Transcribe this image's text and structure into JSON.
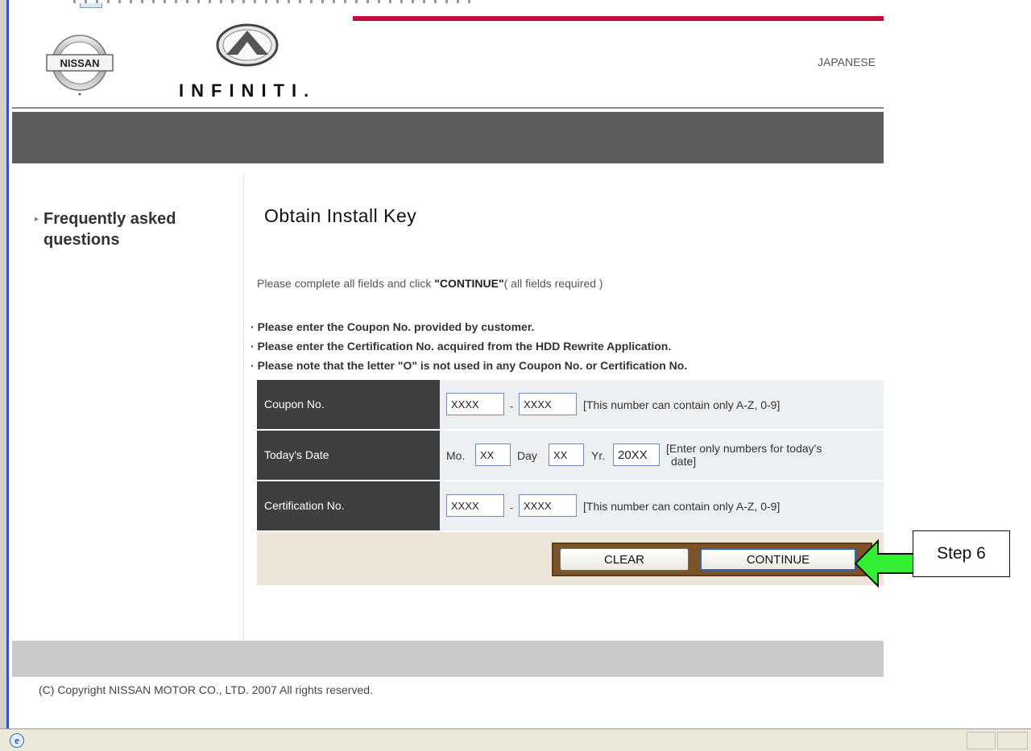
{
  "header": {
    "nissan_logo_text": "NISSAN",
    "infiniti_logo_text": "INFINITI.",
    "language_link": "JAPANESE"
  },
  "sidebar": {
    "faq_label": "Frequently asked questions"
  },
  "main": {
    "title": "Obtain Install Key",
    "instructions": {
      "before": "Please complete all fields and click ",
      "strong": "\"CONTINUE\"",
      "after": "( all fields required )"
    },
    "notes": [
      "Please enter the Coupon No. provided by customer.",
      "Please enter the Certification No. acquired from the HDD Rewrite Application.",
      "Please note that the letter \"O\" is not used in any Coupon No. or Certification No."
    ],
    "note_bullet": "·",
    "form": {
      "coupon": {
        "label": "Coupon No.",
        "part1": "XXXX",
        "separator": "-",
        "part2": "XXXX",
        "hint": "[This number can contain only A-Z, 0-9]"
      },
      "date": {
        "label": "Today's Date",
        "month_label": "Mo.",
        "month_value": "XX",
        "day_label": "Day",
        "day_value": "XX",
        "year_label": "Yr.",
        "year_value": "20XX",
        "hint_line1": "[Enter only numbers for today's",
        "hint_line2": "date]"
      },
      "certification": {
        "label": "Certification No.",
        "part1": "XXXX",
        "separator": "-",
        "part2": "XXXX",
        "hint": "[This number can contain only A-Z, 0-9]"
      }
    },
    "buttons": {
      "clear": "CLEAR",
      "continue": "CONTINUE"
    }
  },
  "annotation": {
    "step_label": "Step 6",
    "arrow_color": "#33ee33"
  },
  "footer": {
    "copyright": "(C) Copyright NISSAN MOTOR CO., LTD. 2007 All rights reserved."
  },
  "colors": {
    "brand_red": "#c40d3a",
    "dark_band": "#5c5c5c",
    "label_bg": "#3f3f3f",
    "button_frame": "#7c5228"
  }
}
